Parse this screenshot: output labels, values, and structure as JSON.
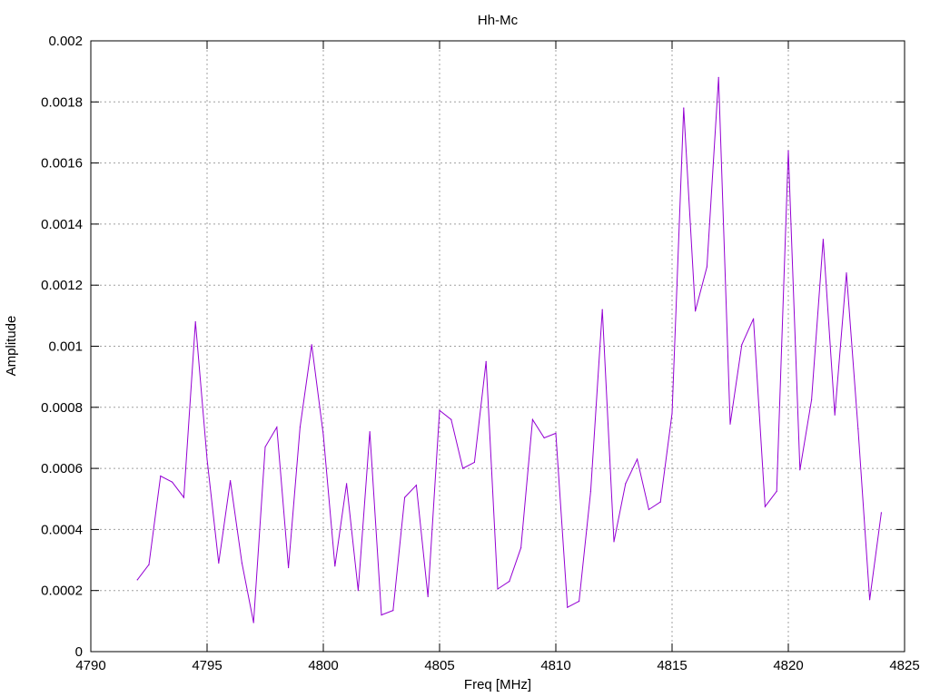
{
  "chart_data": {
    "type": "line",
    "title": "Hh-Mc",
    "xlabel": "Freq [MHz]",
    "ylabel": "Amplitude",
    "xlim": [
      4790,
      4825
    ],
    "ylim": [
      0,
      0.002
    ],
    "x_ticks": [
      4790,
      4795,
      4800,
      4805,
      4810,
      4815,
      4820,
      4825
    ],
    "y_ticks": [
      0,
      0.0002,
      0.0004,
      0.0006,
      0.0008,
      0.001,
      0.0012,
      0.0014,
      0.0016,
      0.0018,
      0.002
    ],
    "x_tick_labels": [
      "4790",
      "4795",
      "4800",
      "4805",
      "4810",
      "4815",
      "4820",
      "4825"
    ],
    "y_tick_labels": [
      "0",
      "0.0002",
      "0.0004",
      "0.0006",
      "0.0008",
      "0.001",
      "0.0012",
      "0.0014",
      "0.0016",
      "0.0018",
      "0.002"
    ],
    "grid": true,
    "legend": "none",
    "series": [
      {
        "color": "#9400d3",
        "x": [
          4792.0,
          4792.5,
          4793.0,
          4793.5,
          4794.0,
          4794.5,
          4795.0,
          4795.5,
          4796.0,
          4796.5,
          4797.0,
          4797.5,
          4798.0,
          4798.5,
          4799.0,
          4799.5,
          4800.0,
          4800.5,
          4801.0,
          4801.5,
          4802.0,
          4802.5,
          4803.0,
          4803.5,
          4804.0,
          4804.5,
          4805.0,
          4805.5,
          4806.0,
          4806.5,
          4807.0,
          4807.5,
          4808.0,
          4808.5,
          4809.0,
          4809.5,
          4810.0,
          4810.5,
          4811.0,
          4811.5,
          4812.0,
          4812.5,
          4813.0,
          4813.5,
          4814.0,
          4814.5,
          4815.0,
          4815.5,
          4816.0,
          4816.5,
          4817.0,
          4817.5,
          4818.0,
          4818.5,
          4819.0,
          4819.5,
          4820.0,
          4820.5,
          4821.0,
          4821.5,
          4822.0,
          4822.5,
          4823.0,
          4823.5,
          4824.0
        ],
        "values": [
          0.000235,
          0.000285,
          0.000575,
          0.000555,
          0.000505,
          0.00108,
          0.00063,
          0.00029,
          0.00056,
          0.00029,
          9.5e-05,
          0.00067,
          0.000735,
          0.000275,
          0.000735,
          0.001005,
          0.00071,
          0.00028,
          0.00055,
          0.0002,
          0.00072,
          0.00012,
          0.000135,
          0.000505,
          0.000545,
          0.00018,
          0.00079,
          0.00076,
          0.0006,
          0.00062,
          0.00095,
          0.000205,
          0.00023,
          0.00034,
          0.00076,
          0.0007,
          0.000715,
          0.000145,
          0.000165,
          0.000525,
          0.00112,
          0.00036,
          0.00055,
          0.00063,
          0.000465,
          0.00049,
          0.00078,
          0.00178,
          0.001115,
          0.00126,
          0.00188,
          0.000745,
          0.001005,
          0.00109,
          0.000475,
          0.000525,
          0.00164,
          0.000595,
          0.000825,
          0.00135,
          0.000775,
          0.00124,
          0.00073,
          0.00017,
          0.000455
        ]
      }
    ]
  }
}
